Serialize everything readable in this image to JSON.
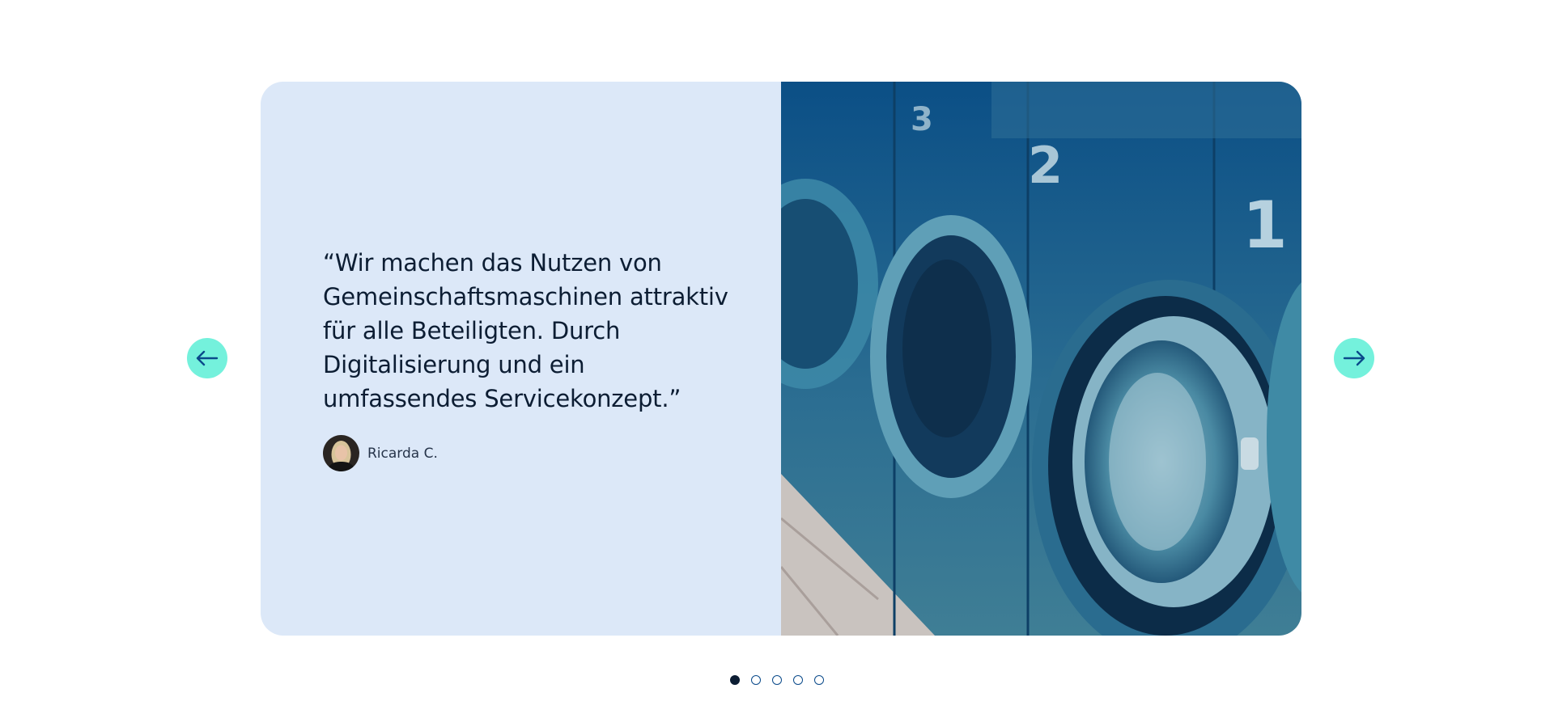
{
  "testimonial": {
    "quote": "“Wir machen das Nutzen von Gemeinschaftsmaschinen attraktiv für alle Beteiligten. Durch Digitalisierung und ein umfassendes Servicekonzept.”",
    "author_name": "Ricarda C."
  },
  "image": {
    "subject": "row of washing machines (laundromat)",
    "machine_numbers": [
      "3",
      "2",
      "1"
    ]
  },
  "navigation": {
    "prev_icon": "arrow-left-icon",
    "next_icon": "arrow-right-icon"
  },
  "pagination": {
    "total": 5,
    "active_index": 0
  },
  "colors": {
    "panel_background": "#dce8f8",
    "nav_button": "#74f1dc",
    "arrow": "#0a4a8a",
    "text": "#0c1d33",
    "image_tint": "#0b4f86"
  }
}
